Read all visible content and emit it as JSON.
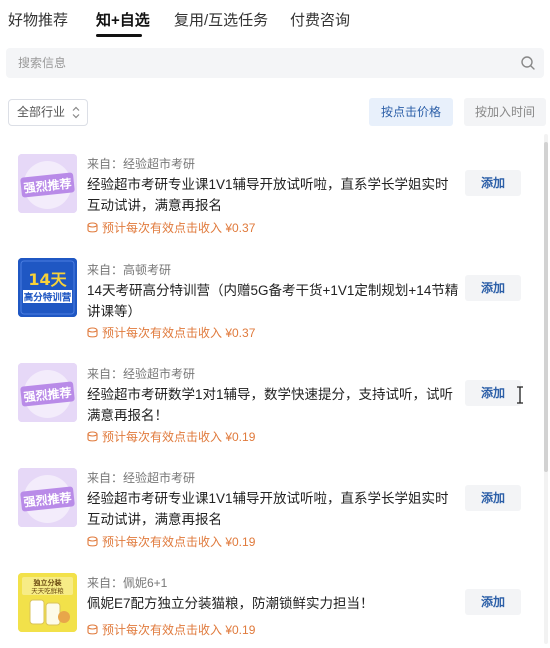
{
  "tabs": [
    {
      "label": "好物推荐"
    },
    {
      "label": "知+自选"
    },
    {
      "label": "复用/互选任务"
    },
    {
      "label": "付费咨询"
    }
  ],
  "search": {
    "placeholder": "搜索信息",
    "icon": "search-icon"
  },
  "filter": {
    "label": "全部行业"
  },
  "sort": {
    "by_price": "按点击价格",
    "by_time": "按加入时间",
    "active": "by_price"
  },
  "items": [
    {
      "thumb_text": "强烈推荐",
      "source": "来自：经验超市考研",
      "title": "经验超市考研专业课1V1辅导开放试听啦，直系学长学姐实时互动试讲，满意再报名",
      "income": "预计每次有效点击收入 ¥0.37",
      "add_label": "添加"
    },
    {
      "thumb_text_1": "14天",
      "thumb_text_2": "高分特训营",
      "source": "来自：高顿考研",
      "title": "14天考研高分特训营（内赠5G备考干货+1V1定制规划+14节精讲课等）",
      "income": "预计每次有效点击收入 ¥0.37",
      "add_label": "添加"
    },
    {
      "thumb_text": "强烈推荐",
      "source": "来自：经验超市考研",
      "title": "经验超市考研数学1对1辅导，数学快速提分，支持试听，试听满意再报名！",
      "income": "预计每次有效点击收入 ¥0.19",
      "add_label": "添加"
    },
    {
      "thumb_text": "强烈推荐",
      "source": "来自：经验超市考研",
      "title": "经验超市考研专业课1V1辅导开放试听啦，直系学长学姐实时互动试讲，满意再报名",
      "income": "预计每次有效点击收入 ¥0.19",
      "add_label": "添加"
    },
    {
      "thumb_text_1": "独立分装",
      "thumb_text_2": "天天吃鲜粮",
      "source": "来自：佩妮6+1",
      "title": "佩妮E7配方独立分装猫粮，防潮锁鲜实力担当！",
      "income": "预计每次有效点击收入 ¥0.19",
      "add_label": "添加"
    }
  ],
  "colors": {
    "accent": "#2c5fa8",
    "income": "#e07a3c",
    "promo_purple": "#b98be8",
    "promo_yellow": "#f2e14a",
    "brand_blue": "#1f57c3"
  }
}
